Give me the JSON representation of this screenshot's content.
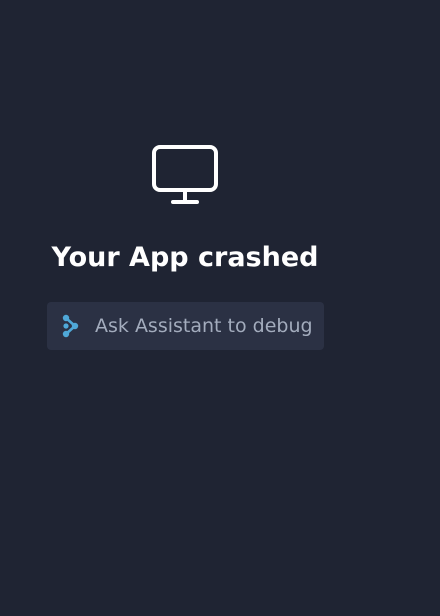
{
  "crash_screen": {
    "icon": "monitor-icon",
    "title": "Your App crashed",
    "debug_button": {
      "icon": "assistant-icon",
      "label": "Ask Assistant to debug"
    }
  },
  "colors": {
    "background": "#1f2433",
    "button_background": "#2b3144",
    "title_text": "#ffffff",
    "button_text": "#a3acbd",
    "assistant_icon": "#4fa8d8"
  }
}
